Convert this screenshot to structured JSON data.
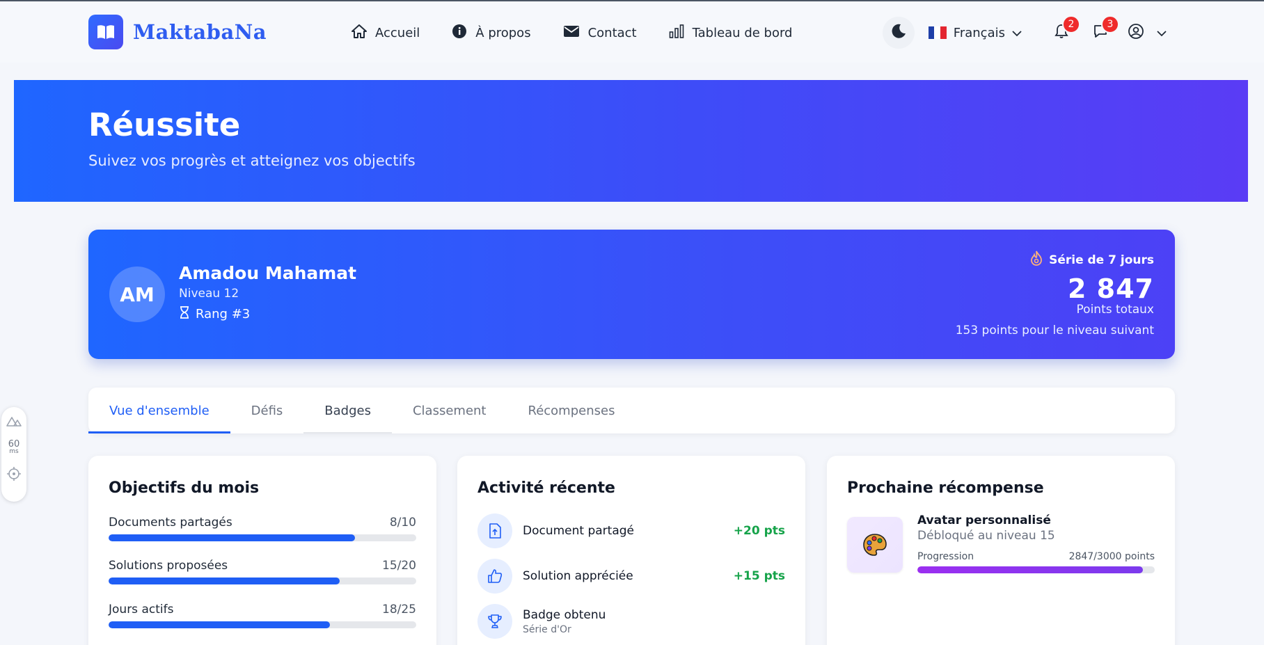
{
  "brand": {
    "name": "MaktabaNa"
  },
  "nav": {
    "links": [
      {
        "label": "Accueil",
        "icon": "home-icon"
      },
      {
        "label": "À propos",
        "icon": "info-icon"
      },
      {
        "label": "Contact",
        "icon": "mail-icon"
      },
      {
        "label": "Tableau de bord",
        "icon": "chart-icon"
      }
    ],
    "language": "Français",
    "notifications_count": "2",
    "messages_count": "3"
  },
  "hero": {
    "title": "Réussite",
    "subtitle": "Suivez vos progrès et atteignez vos objectifs"
  },
  "profile": {
    "initials": "AM",
    "name": "Amadou Mahamat",
    "level": "Niveau 12",
    "rank": "Rang #3",
    "streak": "Série de 7 jours",
    "points": "2 847",
    "points_label": "Points totaux",
    "next_level": "153 points pour le niveau suivant"
  },
  "tabs": [
    {
      "label": "Vue d'ensemble"
    },
    {
      "label": "Défis"
    },
    {
      "label": "Badges"
    },
    {
      "label": "Classement"
    },
    {
      "label": "Récompenses"
    }
  ],
  "goals": {
    "title": "Objectifs du mois",
    "items": [
      {
        "label": "Documents partagés",
        "count": "8/10",
        "progress": 0.8
      },
      {
        "label": "Solutions proposées",
        "count": "15/20",
        "progress": 0.75
      },
      {
        "label": "Jours actifs",
        "count": "18/25",
        "progress": 0.72
      }
    ]
  },
  "activity": {
    "title": "Activité récente",
    "items": [
      {
        "label": "Document partagé",
        "points": "+20 pts",
        "sub": "",
        "icon": "file-upload-icon"
      },
      {
        "label": "Solution appréciée",
        "points": "+15 pts",
        "sub": "",
        "icon": "thumbs-up-icon"
      },
      {
        "label": "Badge obtenu",
        "points": "",
        "sub": "Série d'Or",
        "icon": "trophy-icon"
      }
    ]
  },
  "reward": {
    "title": "Prochaine récompense",
    "name": "Avatar personnalisé",
    "unlock": "Débloqué au niveau 15",
    "progress_label": "Progression",
    "progress_value": "2847/3000 points",
    "progress": 0.949
  },
  "devtools": {
    "ms": "60",
    "unit": "ms"
  },
  "colors": {
    "primary": "#1f5ef5",
    "success": "#16a34a",
    "badge": "#ef2b2b",
    "reward": "#9b2ff0"
  }
}
